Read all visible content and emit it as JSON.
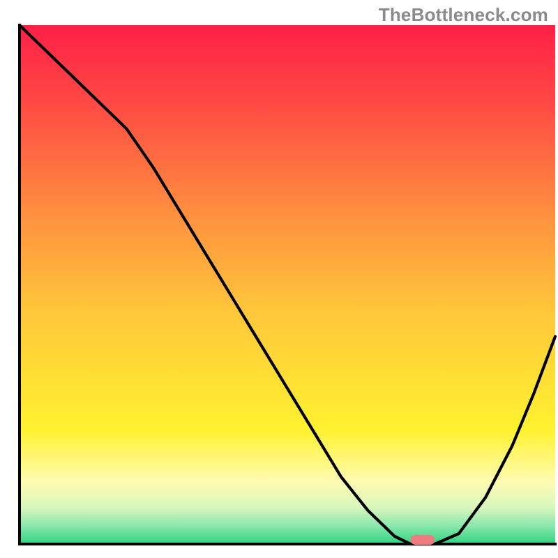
{
  "watermark": "TheBottleneck.com",
  "chart_data": {
    "type": "line",
    "title": "",
    "xlabel": "",
    "ylabel": "",
    "xlim": [
      0,
      100
    ],
    "ylim": [
      0,
      100
    ],
    "grid": false,
    "legend": null,
    "annotations": [],
    "series": [
      {
        "name": "curve",
        "x": [
          0,
          5,
          10,
          15,
          20,
          25,
          30,
          35,
          40,
          45,
          50,
          55,
          60,
          65,
          70,
          73,
          77.5,
          82,
          87,
          92,
          96,
          100
        ],
        "values": [
          100,
          95,
          90,
          85,
          80,
          72.5,
          64,
          55.5,
          47,
          38.5,
          30,
          21.5,
          13,
          6.5,
          1.5,
          0,
          0,
          2,
          9,
          19,
          29,
          40
        ]
      }
    ],
    "marker": {
      "x_start": 73,
      "x_end": 77.5,
      "y": 0
    },
    "background_gradient": {
      "stops": [
        {
          "offset": 0,
          "color": "#ff1f47"
        },
        {
          "offset": 0.15,
          "color": "#ff4944"
        },
        {
          "offset": 0.35,
          "color": "#ff8b3f"
        },
        {
          "offset": 0.55,
          "color": "#ffc63a"
        },
        {
          "offset": 0.78,
          "color": "#fff22f"
        },
        {
          "offset": 0.88,
          "color": "#fffbb1"
        },
        {
          "offset": 0.93,
          "color": "#d7f7bd"
        },
        {
          "offset": 0.965,
          "color": "#89e7ad"
        },
        {
          "offset": 1.0,
          "color": "#2fd47f"
        }
      ]
    },
    "axes": {
      "left": true,
      "bottom": true,
      "right": false,
      "top": false
    }
  }
}
